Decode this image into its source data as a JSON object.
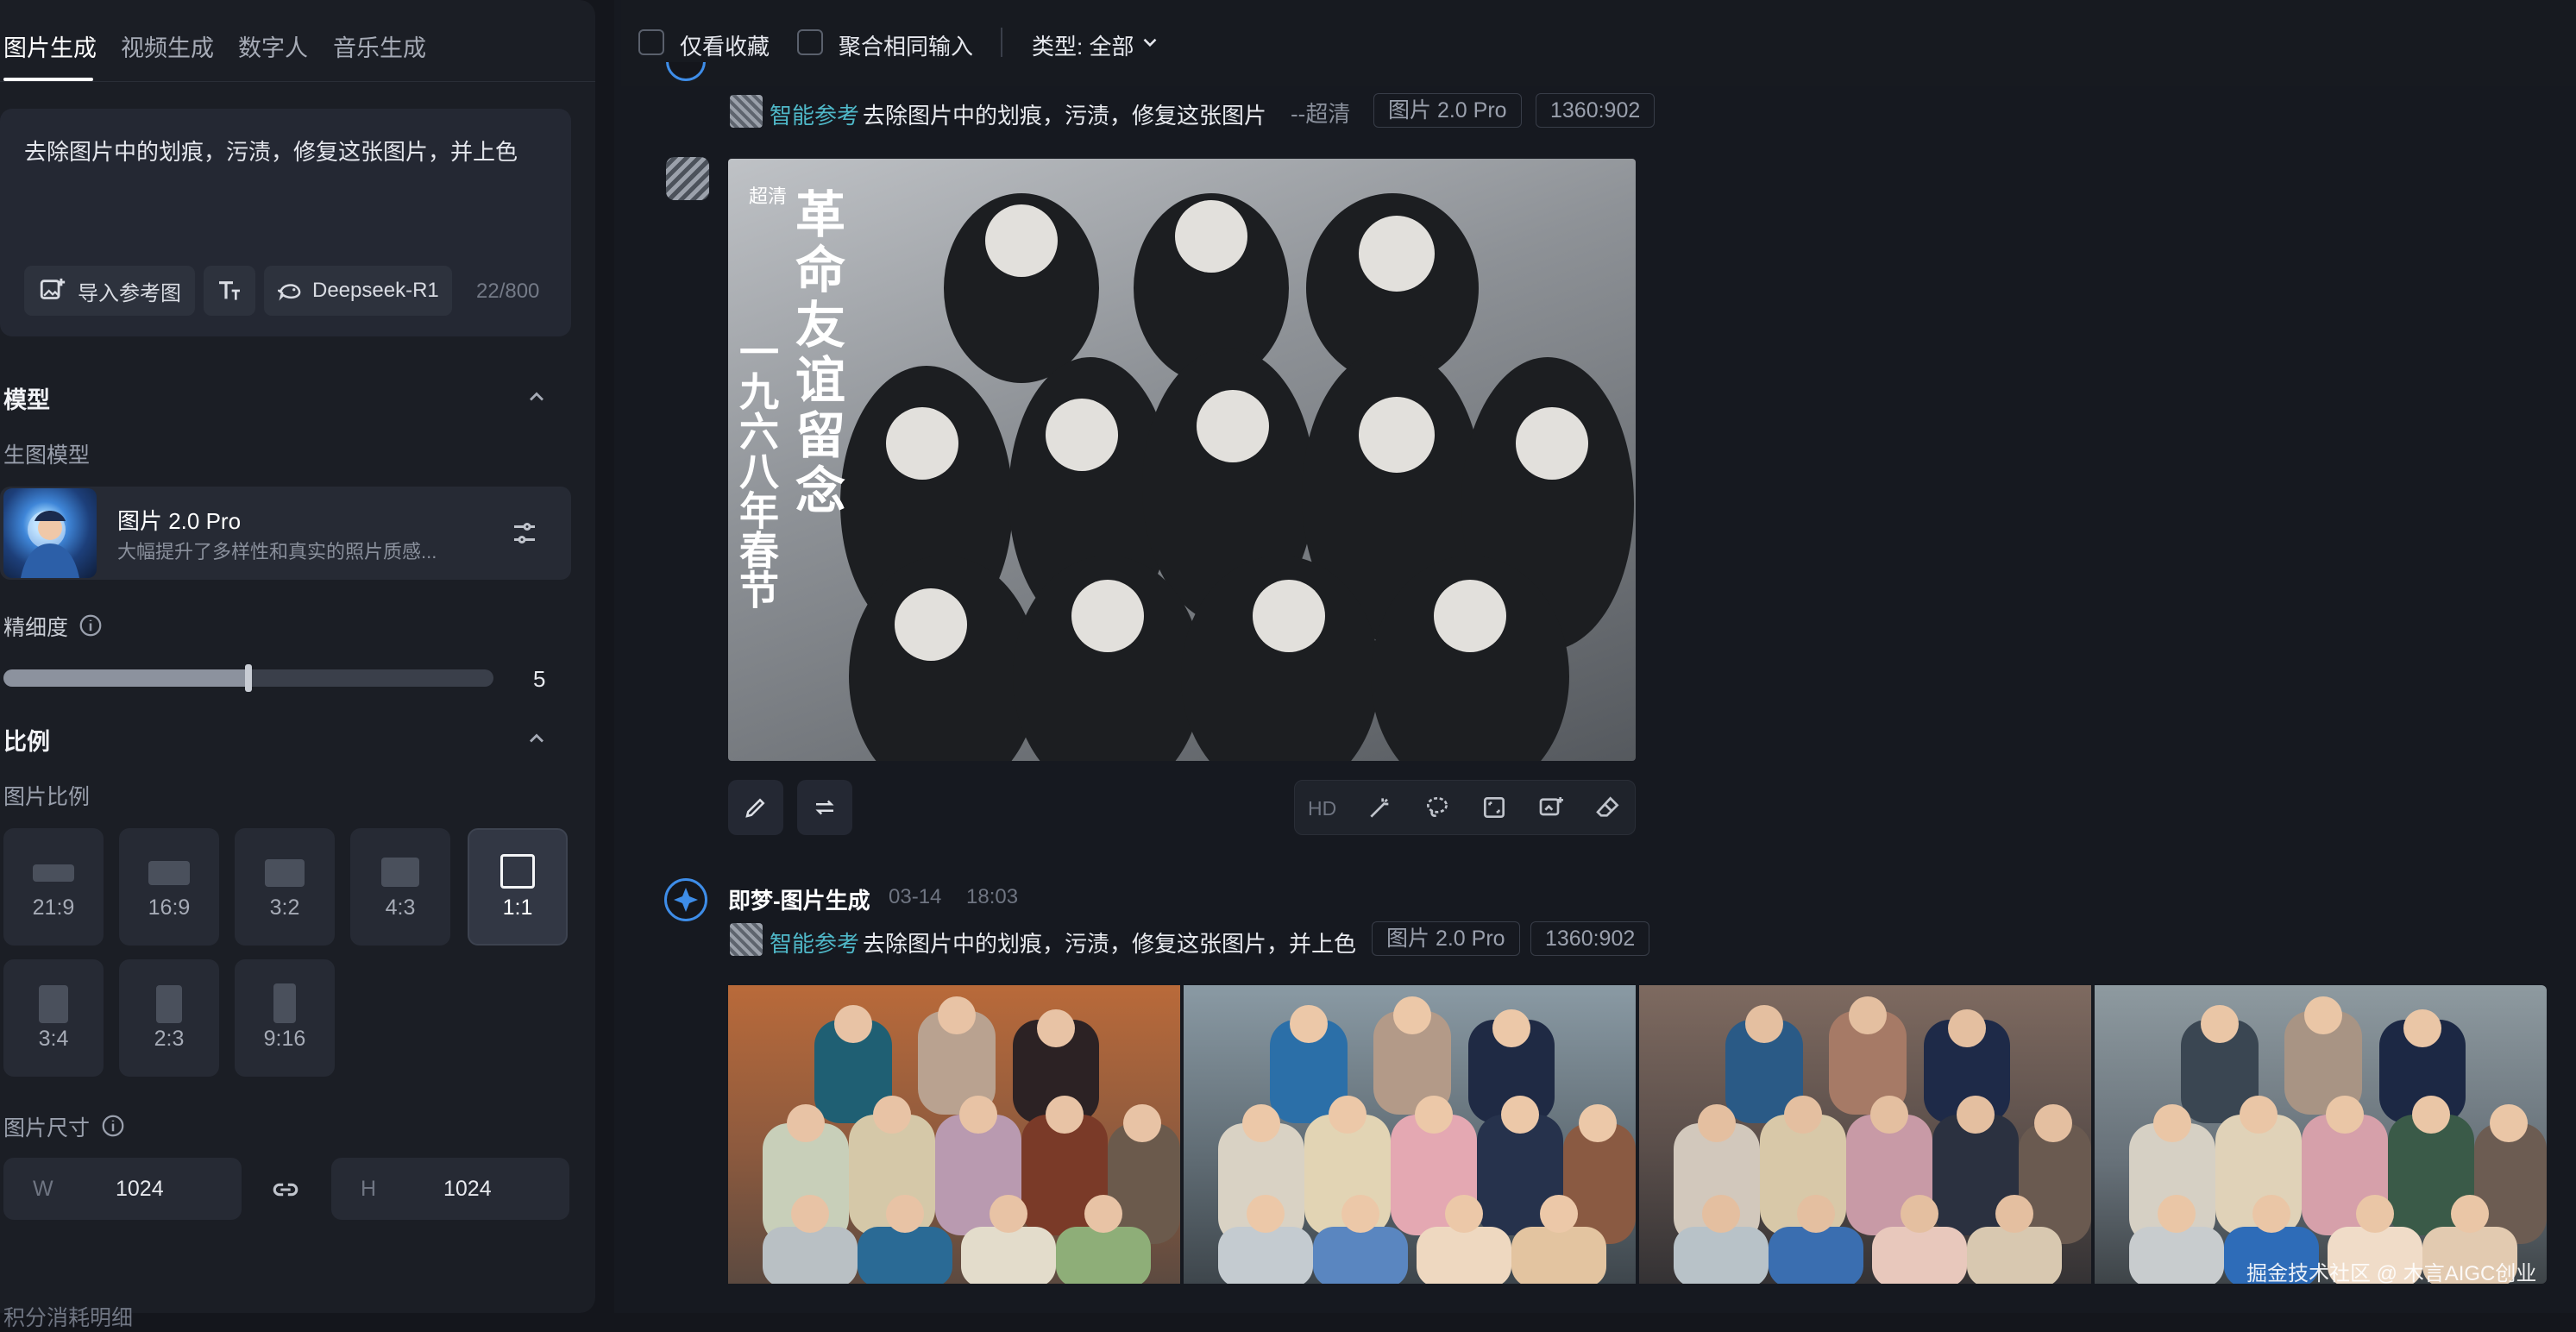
{
  "left_panel": {
    "tabs": [
      {
        "label": "图片生成",
        "active": true
      },
      {
        "label": "视频生成",
        "active": false
      },
      {
        "label": "数字人",
        "active": false
      },
      {
        "label": "音乐生成",
        "active": false
      }
    ],
    "prompt": {
      "text": "去除图片中的划痕，污渍，修复这张图片，并上色",
      "import_button": "导入参考图",
      "model_button": "Deepseek-R1",
      "counter": "22/800"
    },
    "model_section": {
      "title": "模型",
      "sub_label": "生图模型",
      "model_name": "图片 2.0 Pro",
      "model_desc": "大幅提升了多样性和真实的照片质感..."
    },
    "detail": {
      "label": "精细度",
      "value": "5",
      "level_fraction": 0.5
    },
    "ratio_section": {
      "title": "比例",
      "sub_label": "图片比例",
      "options": [
        {
          "label": "21:9",
          "selected": false
        },
        {
          "label": "16:9",
          "selected": false
        },
        {
          "label": "3:2",
          "selected": false
        },
        {
          "label": "4:3",
          "selected": false
        },
        {
          "label": "1:1",
          "selected": true
        },
        {
          "label": "3:4",
          "selected": false
        },
        {
          "label": "2:3",
          "selected": false
        },
        {
          "label": "9:16",
          "selected": false
        }
      ]
    },
    "size": {
      "label": "图片尺寸",
      "w_label": "W",
      "w_value": "1024",
      "h_label": "H",
      "h_value": "1024"
    },
    "credits_label": "积分消耗明细"
  },
  "filter_bar": {
    "favorites_label": "仅看收藏",
    "merge_label": "聚合相同输入",
    "type_label": "类型: 全部"
  },
  "record_1": {
    "ref_label": "智能参考",
    "prompt": "去除图片中的划痕，污渍，修复这张图片",
    "mode": "--超清",
    "model_tag": "图片 2.0 Pro",
    "size_tag": "1360:902",
    "image_badge": "超清",
    "photo_caption": "革命友谊留念",
    "photo_date": "一九六八年春节",
    "tool_hd": "HD"
  },
  "record_2": {
    "app_name": "即梦-图片生成",
    "date": "03-14",
    "time": "18:03",
    "ref_label": "智能参考",
    "prompt": "去除图片中的划痕，污渍，修复这张图片，并上色",
    "model_tag": "图片 2.0 Pro",
    "size_tag": "1360:902"
  },
  "watermark": "掘金技术社区 @ 木言AIGC创业",
  "colors": {
    "accent_teal": "#4fb8c8",
    "logo_blue": "#3e8de8",
    "panel_bg": "#1b1e25",
    "page_bg": "#14161c"
  },
  "icons": [
    "chevron-up-icon",
    "info-icon",
    "settings-sliders-icon",
    "link-icon",
    "edit-icon",
    "swap-icon",
    "magic-wand-icon",
    "lasso-icon",
    "expand-icon",
    "image-add-icon",
    "eraser-icon",
    "chevron-down-icon"
  ]
}
